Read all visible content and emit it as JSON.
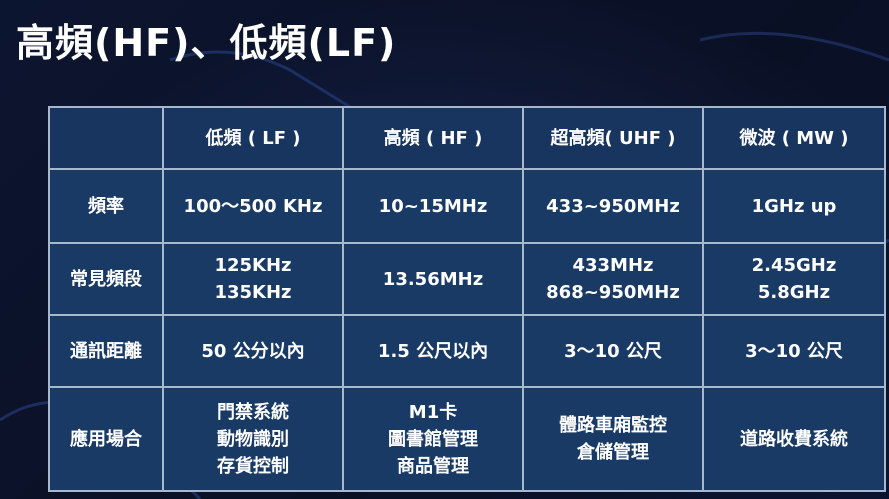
{
  "title": "高頻(HF)、低頻(LF)",
  "colors": {
    "background": "#0b1228",
    "cell": "#1a3a66",
    "border": "#a7b7cc",
    "text": "#ffffff"
  },
  "table": {
    "corner": "",
    "columns": [
      "低頻 ( LF )",
      "高頻 ( HF )",
      "超高頻( UHF )",
      "微波 ( MW )"
    ],
    "rows": [
      {
        "label": "頻率",
        "cells": [
          [
            "100～500 KHz"
          ],
          [
            "10~15MHz"
          ],
          [
            "433~950MHz"
          ],
          [
            "1GHz up"
          ]
        ]
      },
      {
        "label": "常見頻段",
        "cells": [
          [
            "125KHz",
            "135KHz"
          ],
          [
            "13.56MHz"
          ],
          [
            "433MHz",
            "868~950MHz"
          ],
          [
            "2.45GHz",
            "5.8GHz"
          ]
        ]
      },
      {
        "label": "通訊距離",
        "cells": [
          [
            "50 公分以內"
          ],
          [
            "1.5 公尺以內"
          ],
          [
            "3～10 公尺"
          ],
          [
            "3～10 公尺"
          ]
        ]
      },
      {
        "label": "應用場合",
        "cells": [
          [
            "門禁系統",
            "動物識別",
            "存貨控制"
          ],
          [
            "M1卡",
            "圖書館管理",
            "商品管理"
          ],
          [
            "體路車廂監控",
            "倉儲管理"
          ],
          [
            "道路收費系統"
          ]
        ]
      }
    ]
  }
}
